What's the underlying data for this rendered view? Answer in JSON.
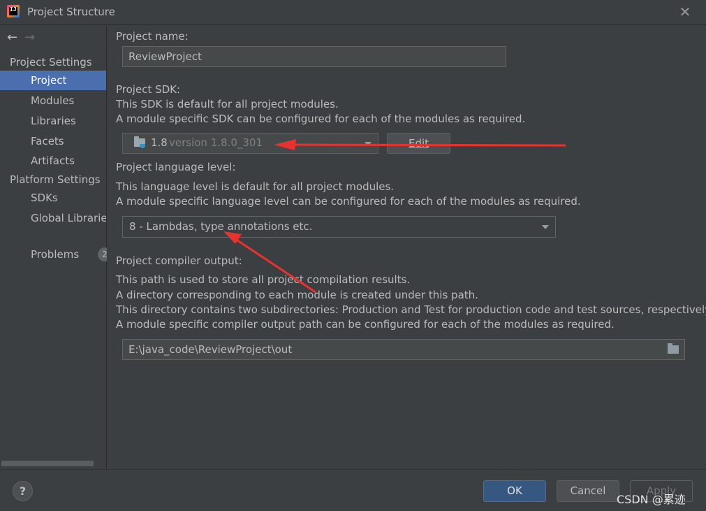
{
  "window": {
    "title": "Project Structure",
    "app_icon_text": "IJ"
  },
  "nav": {
    "back_glyph": "←",
    "forward_glyph": "→"
  },
  "sidebar": {
    "project_settings_header": "Project Settings",
    "project_settings_items": [
      {
        "label": "Project",
        "selected": true
      },
      {
        "label": "Modules",
        "selected": false
      },
      {
        "label": "Libraries",
        "selected": false
      },
      {
        "label": "Facets",
        "selected": false
      },
      {
        "label": "Artifacts",
        "selected": false
      }
    ],
    "platform_settings_header": "Platform Settings",
    "platform_settings_items": [
      {
        "label": "SDKs"
      },
      {
        "label": "Global Libraries"
      }
    ],
    "problems_label": "Problems",
    "problems_count": "2"
  },
  "main": {
    "project_name_label": "Project name:",
    "project_name_value": "ReviewProject",
    "sdk_label": "Project SDK:",
    "sdk_desc_1": "This SDK is default for all project modules.",
    "sdk_desc_2": "A module specific SDK can be configured for each of the modules as required.",
    "sdk_name": "1.8",
    "sdk_version": "version 1.8.0_301",
    "edit_label": "Edit",
    "lang_label": "Project language level:",
    "lang_desc_1": "This language level is default for all project modules.",
    "lang_desc_2": "A module specific language level can be configured for each of the modules as required.",
    "lang_value": "8 - Lambdas, type annotations etc.",
    "output_label": "Project compiler output:",
    "output_desc_1": "This path is used to store all project compilation results.",
    "output_desc_2": "A directory corresponding to each module is created under this path.",
    "output_desc_3": "This directory contains two subdirectories: Production and Test for production code and test sources, respectively.",
    "output_desc_4": "A module specific compiler output path can be configured for each of the modules as required.",
    "output_path": "E:\\java_code\\ReviewProject\\out"
  },
  "footer": {
    "help_label": "?",
    "ok_label": "OK",
    "cancel_label": "Cancel",
    "apply_label": "Apply",
    "watermark": "CSDN @累迹"
  },
  "colors": {
    "background": "#3c3f41",
    "selection": "#4b6eaf",
    "ok_button": "#365880",
    "annotation_arrow": "#e8322f"
  },
  "icons": [
    "app-icon",
    "back-arrow-icon",
    "forward-arrow-icon",
    "close-icon",
    "folder-sdk-icon",
    "chevron-down-icon",
    "browse-folder-icon",
    "help-icon"
  ]
}
